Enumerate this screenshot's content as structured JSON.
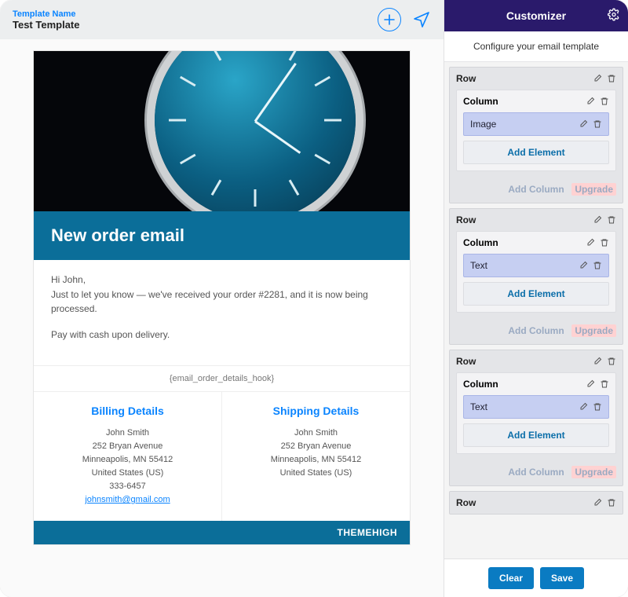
{
  "header": {
    "template_label": "Template Name",
    "template_name": "Test Template"
  },
  "email": {
    "banner_title": "New order email",
    "greeting": "Hi John,",
    "intro": "Just to let you know — we've received your order #2281, and it is now being processed.",
    "payment_note": "Pay with cash upon delivery.",
    "hook_placeholder": "{email_order_details_hook}",
    "billing": {
      "title": "Billing Details",
      "name": "John Smith",
      "street": "252 Bryan Avenue",
      "city": "Minneapolis, MN 55412",
      "country": "United States (US)",
      "phone": "333-6457",
      "email": "johnsmith@gmail.com"
    },
    "shipping": {
      "title": "Shipping Details",
      "name": "John Smith",
      "street": "252 Bryan Avenue",
      "city": "Minneapolis, MN 55412",
      "country": "United States (US)"
    },
    "footer_brand": "THEMEHIGH"
  },
  "customizer": {
    "title": "Customizer",
    "subtitle": "Configure your email template",
    "row_label": "Row",
    "column_label": "Column",
    "add_element_label": "Add Element",
    "add_column_label": "Add Column",
    "upgrade_label": "Upgrade",
    "rows": [
      {
        "element_label": "Image"
      },
      {
        "element_label": "Text"
      },
      {
        "element_label": "Text"
      }
    ],
    "extra_row": true,
    "clear_label": "Clear",
    "save_label": "Save"
  }
}
